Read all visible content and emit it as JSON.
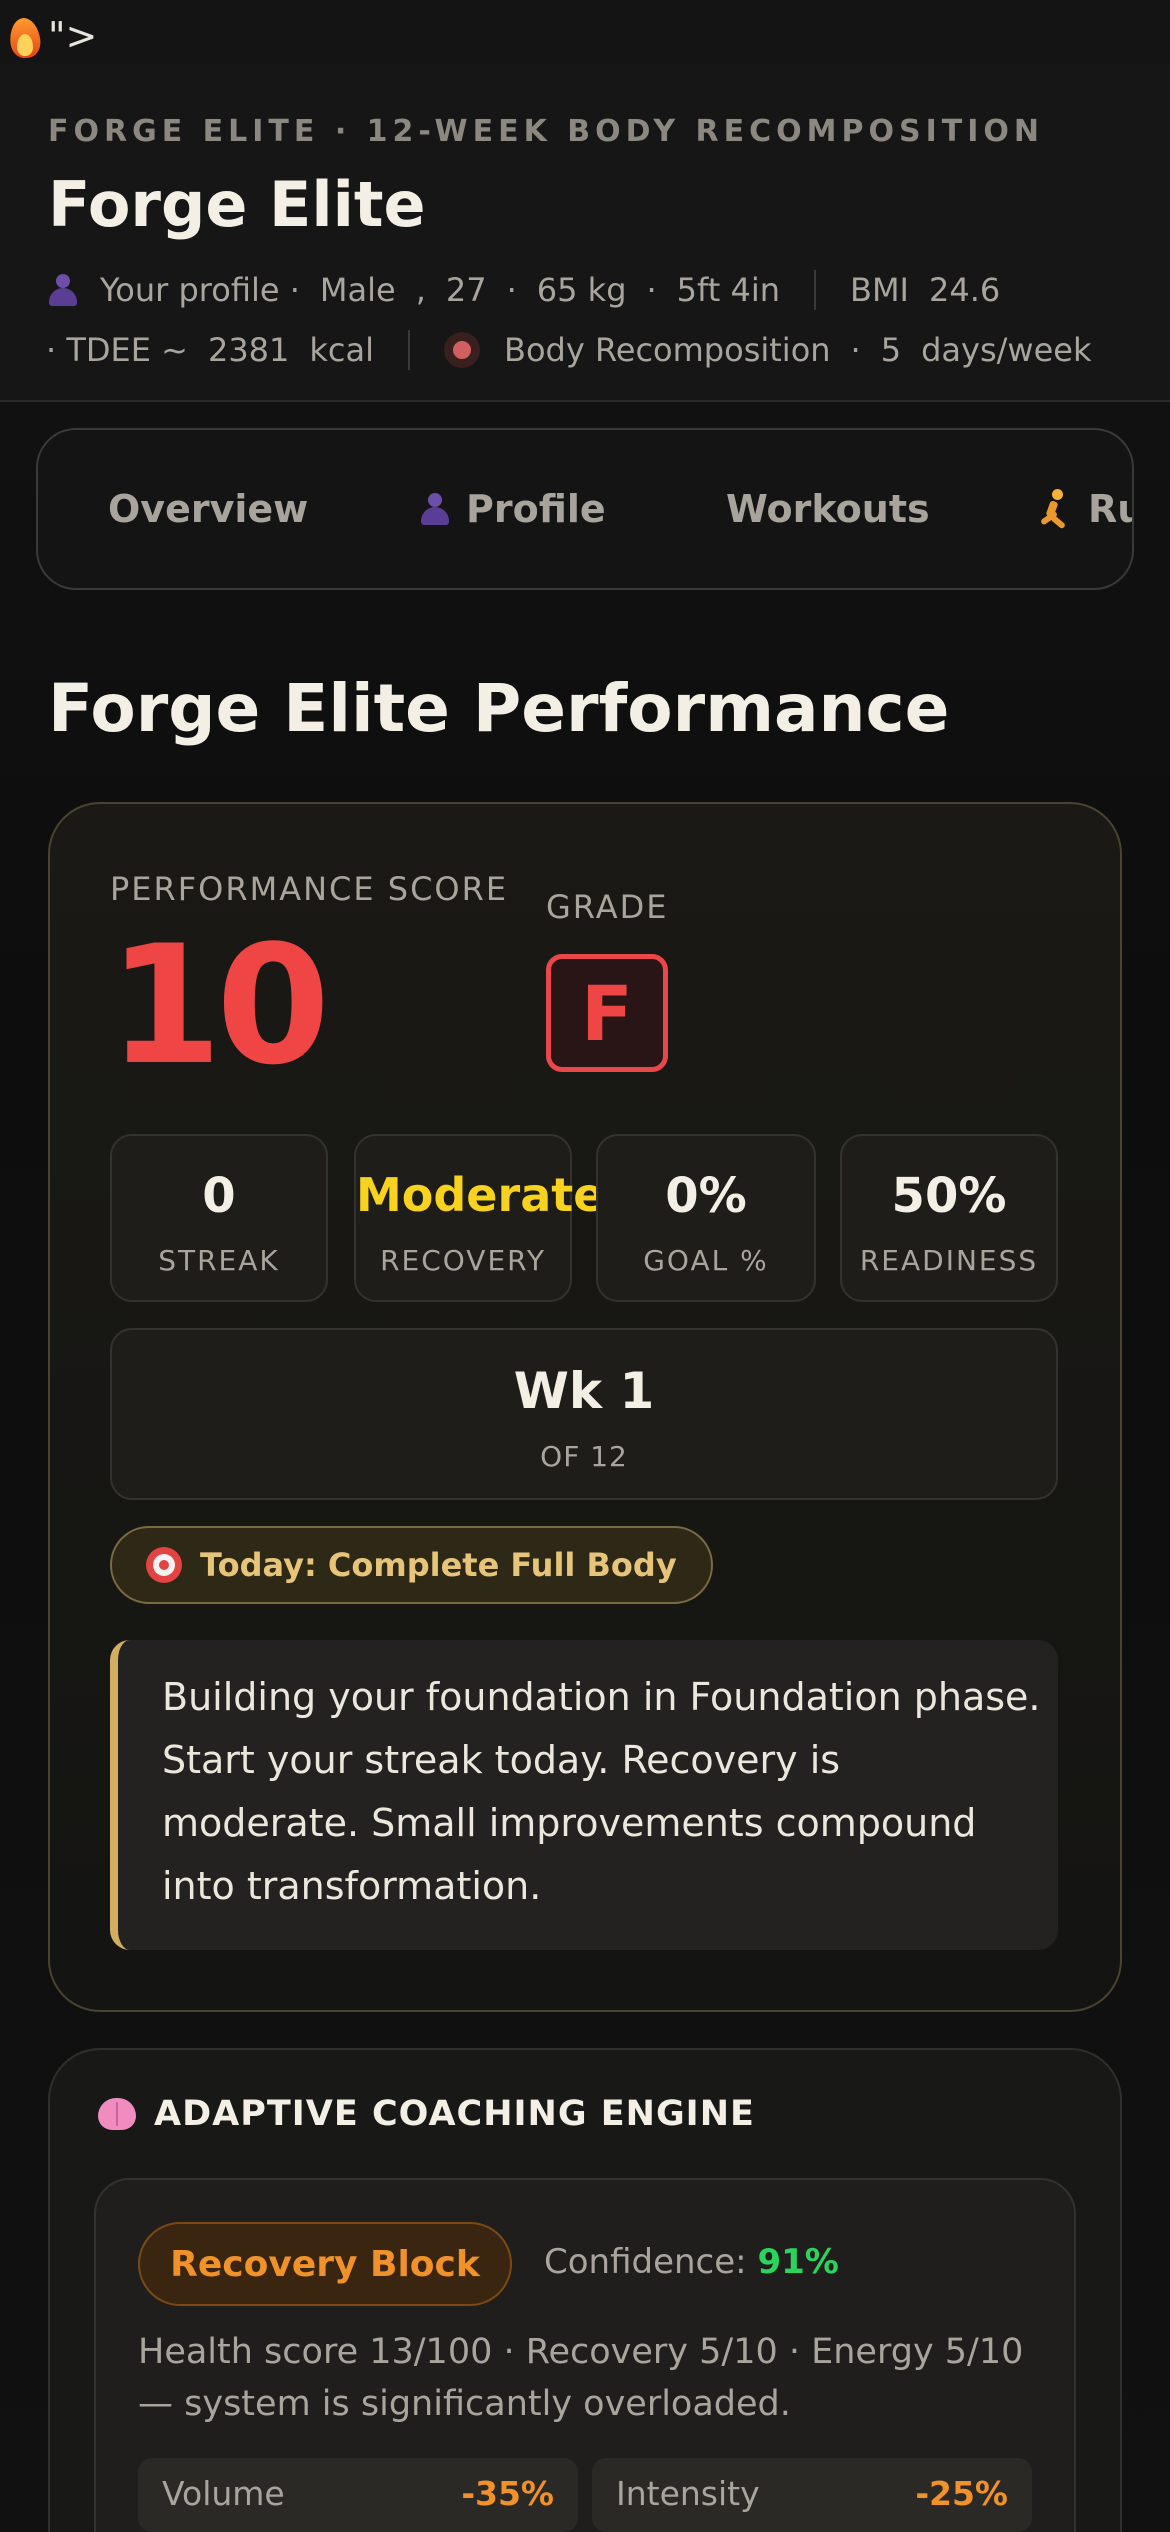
{
  "stray_text": "\">",
  "header": {
    "eyebrow": "FORGE ELITE · 12-WEEK BODY RECOMPOSITION",
    "title": "Forge Elite",
    "profile": {
      "label": "Your profile ·",
      "sex": "Male",
      "comma": ",",
      "age": "27",
      "dot1": "·",
      "weight": "65 kg",
      "dot2": "·",
      "height": "5ft 4in",
      "bmi_label": "BMI",
      "bmi_value": "24.6",
      "tdee_label": "· TDEE ~",
      "tdee_value": "2381",
      "tdee_unit": "kcal",
      "goal": "Body Recomposition",
      "dot3": "·",
      "days": "5",
      "days_unit": "days/week"
    }
  },
  "tabs": [
    {
      "label": "Overview"
    },
    {
      "label": "Profile"
    },
    {
      "label": "Workouts"
    },
    {
      "label": "Ru"
    }
  ],
  "section_title": "Forge Elite Performance",
  "performance": {
    "score_label": "PERFORMANCE SCORE",
    "score_value": "10",
    "grade_label": "GRADE",
    "grade_value": "F",
    "stats": [
      {
        "value": "0",
        "label": "STREAK"
      },
      {
        "value": "Moderate",
        "label": "RECOVERY"
      },
      {
        "value": "0%",
        "label": "GOAL %"
      },
      {
        "value": "50%",
        "label": "READINESS"
      }
    ],
    "week": {
      "value": "Wk 1",
      "label": "OF 12"
    },
    "today": "Today: Complete Full Body",
    "message": "Building your foundation in Foundation phase. Start your streak today. Recovery is moderate. Small improvements compound into transformation."
  },
  "coaching": {
    "title": "ADAPTIVE COACHING ENGINE",
    "block": "Recovery Block",
    "confidence_label": "Confidence:",
    "confidence_value": "91%",
    "description": "Health score 13/100 · Recovery 5/10 · Energy 5/10 — system is significantly overloaded.",
    "adjustments": [
      {
        "name": "Volume",
        "delta": "-35%"
      },
      {
        "name": "Intensity",
        "delta": "-25%"
      }
    ]
  },
  "colors": {
    "score": "#f04545",
    "recovery_highlight": "#f7d31f",
    "accent_gold": "#d2ad62",
    "block_orange": "#f0912a",
    "confidence_green": "#2bd45f"
  },
  "icons": {
    "stray": "flame-icon",
    "profile": "user-icon",
    "goal": "red-dot-icon",
    "runner": "runner-icon",
    "today": "target-icon",
    "coaching": "brain-icon"
  }
}
